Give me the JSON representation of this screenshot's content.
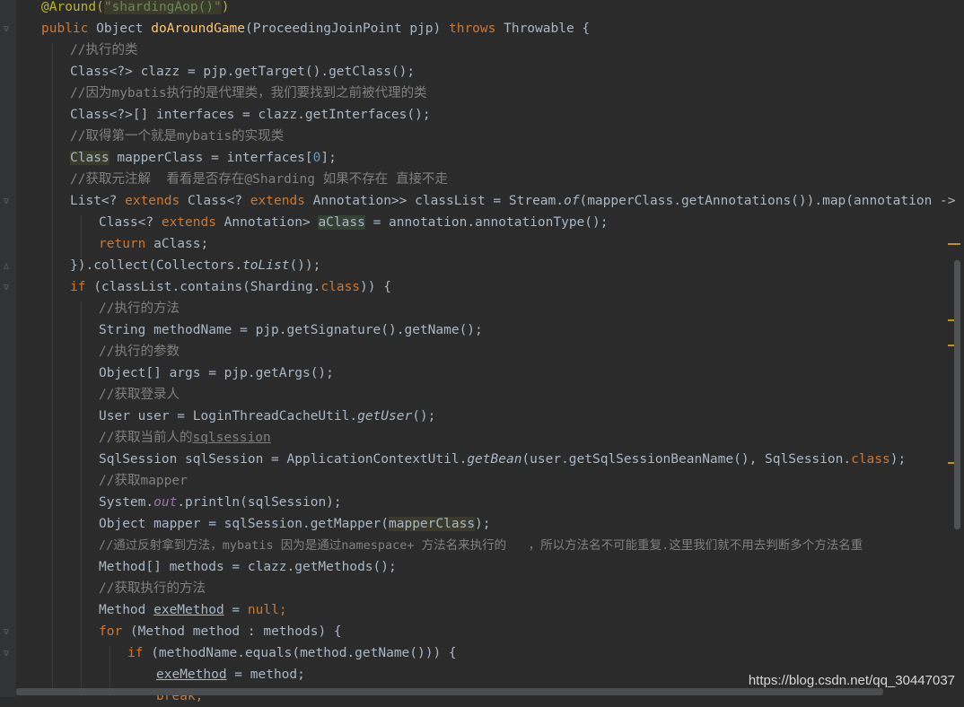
{
  "code": {
    "l0_a": "@Around(",
    "l0_b": "\"shardingAop()\"",
    "l0_c": ")",
    "l1_kw": "public",
    "l1_a": " Object ",
    "l1_fn": "doAroundGame",
    "l1_b": "(ProceedingJoinPoint pjp) ",
    "l1_kw2": "throws",
    "l1_c": " Throwable {",
    "l2": "//执行的类",
    "l3": "Class<?> clazz = pjp.getTarget().getClass();",
    "l4": "//因为mybatis执行的是代理类，我们要找到之前被代理的类",
    "l5": "Class<?>[] interfaces = clazz.getInterfaces();",
    "l6": "//取得第一个就是mybatis的实现类",
    "l7_a": "Class",
    "l7_b": " mapperClass = interfaces[",
    "l7_n": "0",
    "l7_c": "];",
    "l8": "//获取元注解  看看是否存在@Sharding 如果不存在 直接不走",
    "l9_a": "List<? ",
    "l9_kw": "extends",
    "l9_b": " Class<? ",
    "l9_kw2": "extends",
    "l9_c": " Annotation>> classList = Stream.",
    "l9_it": "of",
    "l9_d": "(mapperClass.getAnnotations()).map(annotation -> {",
    "l10_a": "Class<? ",
    "l10_kw": "extends",
    "l10_b": " Annotation> ",
    "l10_hl": "aClass",
    "l10_c": " = annotation.annotationType();",
    "l11_kw": "return",
    "l11_a": " aClass;",
    "l12_a": "}).collect(Collectors.",
    "l12_it": "toList",
    "l12_b": "());",
    "l13_kw": "if",
    "l13_a": " (classList.contains(Sharding.",
    "l13_kw2": "class",
    "l13_b": ")) {",
    "l14": "//执行的方法",
    "l15": "String methodName = pjp.getSignature().getName();",
    "l16": "//执行的参数",
    "l17": "Object[] args = pjp.getArgs();",
    "l18": "//获取登录人",
    "l19_a": "User user = LoginThreadCacheUtil.",
    "l19_it": "getUser",
    "l19_b": "();",
    "l20_a": "//获取当前人的",
    "l20_ul": "sqlsession",
    "l21_a": "SqlSession sqlSession = ApplicationContextUtil.",
    "l21_it": "getBean",
    "l21_b": "(user.getSqlSessionBeanName(), SqlSession.",
    "l21_kw": "class",
    "l21_c": ");",
    "l22": "//获取mapper",
    "l23_a": "System.",
    "l23_sf": "out",
    "l23_b": ".println(sqlSession);",
    "l24_a": "Object mapper = sqlSession.getMapper(",
    "l24_hl": "mapperClass",
    "l24_b": ");",
    "l25": "//通过反射拿到方法，mybatis 因为是通过namespace+ 方法名来执行的   ，所以方法名不可能重复.这里我们就不用去判断多个方法名重",
    "l26": "Method[] methods = clazz.getMethods();",
    "l27": "//获取执行的方法",
    "l28_a": "Method ",
    "l28_ul": "exeMethod",
    "l28_b": " = ",
    "l28_kw": "null",
    "l28_c": ";",
    "l29_kw": "for",
    "l29_a": " (Method method : methods) {",
    "l30_kw": "if",
    "l30_a": " (methodName.equals(method.getName())) {",
    "l31_ul": "exeMethod",
    "l31_a": " = method;",
    "l32_kw": "break",
    "l32_a": ";"
  },
  "watermark": "https://blog.csdn.net/qq_30447037",
  "colors": {
    "background": "#2b2b2b",
    "keyword": "#cc7832",
    "comment": "#808080",
    "method_decl": "#ffc66d",
    "annotation": "#bbb529",
    "string": "#6a8759",
    "number": "#6897bb",
    "text": "#a9b7c6"
  }
}
